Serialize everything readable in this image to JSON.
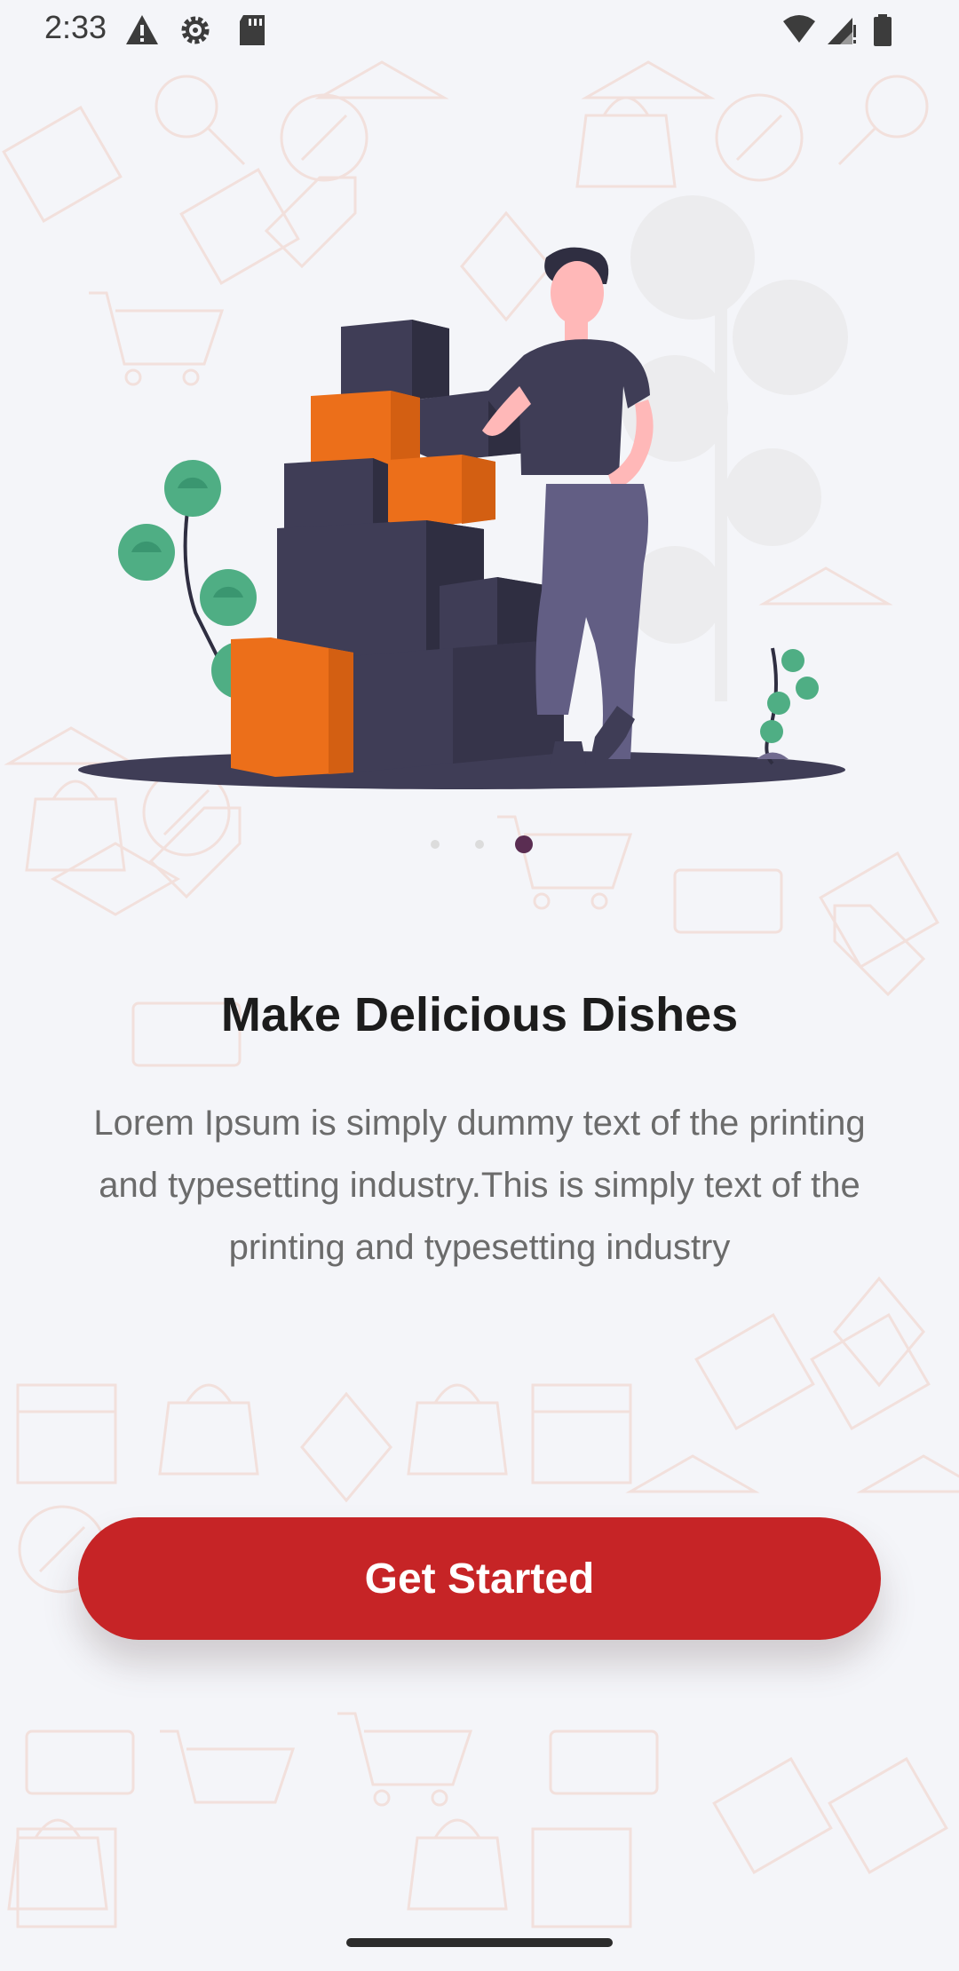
{
  "status_bar": {
    "time": "2:33",
    "left_icons": [
      "warning-icon",
      "settings-icon",
      "sd-card-icon"
    ],
    "right_icons": [
      "wifi-icon",
      "cell-signal-icon",
      "battery-icon"
    ]
  },
  "onboarding": {
    "page_index": 3,
    "page_count": 3,
    "title": "Make Delicious Dishes",
    "description": "Lorem Ipsum is simply dummy text of the printing and typesetting industry.This is simply text of the printing and typesetting industry",
    "cta_label": "Get Started"
  },
  "colors": {
    "accent": "#c62426",
    "active_dot": "#5a2d52",
    "inactive_dot": "#dcdcdc",
    "background": "#f4f5f9"
  }
}
